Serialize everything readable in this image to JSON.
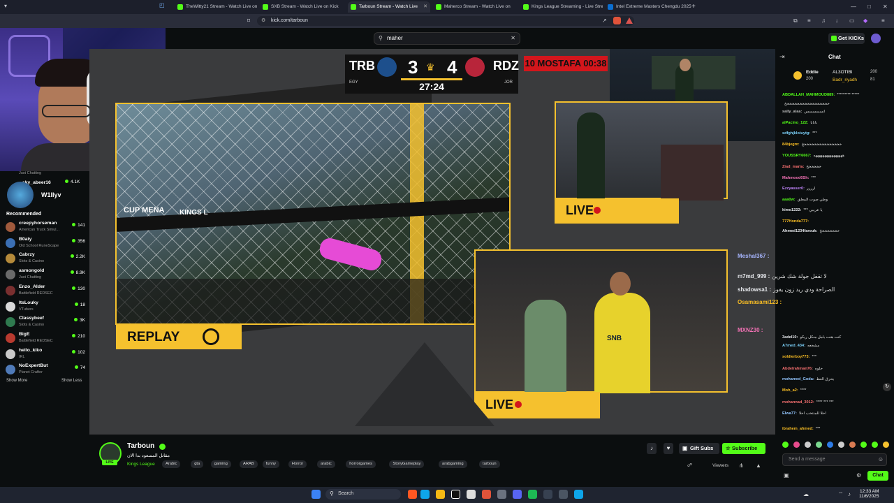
{
  "browser": {
    "tabs": [
      {
        "label": "TheWitty21 Stream - Watch Live on K",
        "active": false
      },
      {
        "label": "SXB Stream - Watch Live on Kick",
        "active": false
      },
      {
        "label": "Tarboun Stream - Watch Live",
        "active": true
      },
      {
        "label": "Maherco Stream - Watch Live on",
        "active": false
      },
      {
        "label": "Kings League Streaming - Live Strea",
        "active": false
      },
      {
        "label": "Intel Extreme Masters Chengdu 2025",
        "active": false
      }
    ],
    "new_tab_symbol": "+",
    "url": "kick.com/tarboun"
  },
  "header": {
    "search_value": "maher",
    "get_kicks_label": "Get KICKs"
  },
  "sidebar": {
    "top_item": {
      "category": "Just Chatting"
    },
    "partial_item": {
      "name": "sky_abeer16",
      "viewers": "4.1K"
    },
    "webcam_overlay_name": "W1llyv",
    "section_title": "Recommended",
    "items": [
      {
        "name": "creepyhorseman",
        "category": "American Truck Simul...",
        "viewers": "141",
        "color": "#a05a3c"
      },
      {
        "name": "B0aty",
        "category": "Old School RuneScape",
        "viewers": "356",
        "color": "#3b6fb4"
      },
      {
        "name": "Cabrzy",
        "category": "Slots & Casino",
        "viewers": "2.2K",
        "color": "#b58a3a"
      },
      {
        "name": "asmongold",
        "category": "Just Chatting",
        "viewers": "8.9K",
        "color": "#6a6a6a"
      },
      {
        "name": "Enzo_Alder",
        "category": "Battlefield REDSEC",
        "viewers": "130",
        "color": "#7a2f2f"
      },
      {
        "name": "ItsLouky",
        "category": "VTubers",
        "viewers": "18",
        "color": "#d9d9d9"
      },
      {
        "name": "Classybeef",
        "category": "Slots & Casino",
        "viewers": "3K",
        "color": "#2f7a4f"
      },
      {
        "name": "BigE",
        "category": "Battlefield REDSEC",
        "viewers": "210",
        "color": "#b83a2f"
      },
      {
        "name": "hello_kiko",
        "category": "IRL",
        "viewers": "102",
        "color": "#c9c9c9"
      },
      {
        "name": "NoExpertBut",
        "category": "Planet Crafter",
        "viewers": "74",
        "color": "#4f7ab8"
      }
    ],
    "show_more": "Show More",
    "show_less": "Show Less"
  },
  "video": {
    "scoreboard": {
      "home": "TRB",
      "home_score": "3",
      "away_score": "4",
      "away": "RDZ",
      "clock": "27:24",
      "home_country": "EGY",
      "away_country": "JOR"
    },
    "red_banner": "10 MOSTAFA 00:38",
    "replay_label": "REPLAY",
    "live_label": "LIVE",
    "ad_text_left": "CUP MENA",
    "ad_text_right": "KINGS L",
    "jersey_text": "SNB"
  },
  "chat": {
    "title": "Chat",
    "gifters": [
      {
        "name": "Eddie",
        "amount": "200"
      },
      {
        "name": "AL3OTIBI",
        "amount": "200"
      },
      {
        "name": "Badr_riyadh",
        "amount": "81"
      }
    ],
    "messages": [
      {
        "user": "ABDALLAH_MAHMOUD889:",
        "text": "********* *****",
        "color": "#53fc18"
      },
      {
        "user": "",
        "text": "خخخخخخخخخخخخخخخخخخ",
        "color": "#ddd"
      },
      {
        "user": "sally_alaa:",
        "text": "انسسسسس",
        "color": "#bbbbbb"
      },
      {
        "user": "alPacino_122:",
        "text": "نانانا",
        "color": "#53fc18"
      },
      {
        "user": "sdfghjkloiuytg:",
        "text": "***",
        "color": "#7dd3fc"
      },
      {
        "user": "84bjegm:",
        "text": "خخخخخخخخخخخخخخخخ",
        "color": "#fbbf24"
      },
      {
        "user": "YOUSSRY6667:",
        "text": "ههههههههههههههههه",
        "color": "#53fc18"
      },
      {
        "user": "Ziad_maria:",
        "text": "خخخخخخ",
        "color": "#f87171"
      },
      {
        "user": "Mahmood0Sh:",
        "text": "***",
        "color": "#f472b6"
      },
      {
        "user": "Ezzyasser0:",
        "text": "ارررر",
        "color": "#c084fc"
      },
      {
        "user": "aaa0w:",
        "text": "وطي صوت المعلق",
        "color": "#53fc18"
      },
      {
        "user": "kimo1222:",
        "text": "*** يا عريبي",
        "color": "#e5e7eb"
      },
      {
        "user": "777Honda777:",
        "text": "",
        "color": "#fbbf24"
      },
      {
        "user": "Ahmed1234farouk:",
        "text": "خخخخخخخخ",
        "color": "#e5e7eb"
      },
      {
        "user": "Meshal367 :",
        "text": "",
        "color": "#a5b4fc"
      },
      {
        "user": "m7md_999 :",
        "text": "لا تقفل جولة شك شرين",
        "color": "#e5e7eb"
      },
      {
        "user": "shadowsa1 :",
        "text": "الصراحة ودي ريد زون يفوز",
        "color": "#e5e7eb"
      },
      {
        "user": "Osamasami123 :",
        "text": "",
        "color": "#fbbf24"
      },
      {
        "user": "MXNZ30 :",
        "text": "",
        "color": "#f472b6"
      },
      {
        "user": "3adel10:",
        "text": "كنت هنت بامل منكل ريكو",
        "color": "#e5e7eb"
      },
      {
        "user": "A7med_434:",
        "text": "مشجعه",
        "color": "#7dd3fc"
      },
      {
        "user": "soldierboy773:",
        "text": "***",
        "color": "#fbbf24"
      },
      {
        "user": "Abdelrahman76:",
        "text": "حلوه",
        "color": "#f87171"
      },
      {
        "user": "mohamed_Goda:",
        "text": "يحرق العظ",
        "color": "#93c5fd"
      },
      {
        "user": "Moh_a2:",
        "text": "****",
        "color": "#fbbf24"
      },
      {
        "user": "mohannad_3012:",
        "text": "**** *** ***",
        "color": "#f87171"
      },
      {
        "user": "Elwa77:",
        "text": "أحلا للمنتخب احلا",
        "color": "#93c5fd"
      },
      {
        "user": "ibrahem_ahmed:",
        "text": "***",
        "color": "#fbbf24"
      }
    ],
    "input_placeholder": "Send a message",
    "chat_button": "Chat"
  },
  "channel": {
    "name": "Tarboun",
    "live_badge": "LIVE",
    "title": "مقاتل المسعود بدا الان",
    "category": "Kings League",
    "tags": [
      "Arabic",
      "gta",
      "gaming",
      "ARAB",
      "funny",
      "Horror",
      "arabic",
      "horrorgames",
      "StoryGameplay",
      "arabgaming",
      "tarboun"
    ],
    "gift_subs": "Gift Subs",
    "subscribe": "Subscribe",
    "viewers_label": "Viewers"
  },
  "taskbar": {
    "search": "Search",
    "time": "12:33 AM",
    "date": "11/6/2025"
  },
  "colors": {
    "kick_green": "#53fc18",
    "background": "#0b0e0f",
    "accent_yellow": "#f5c12e"
  }
}
